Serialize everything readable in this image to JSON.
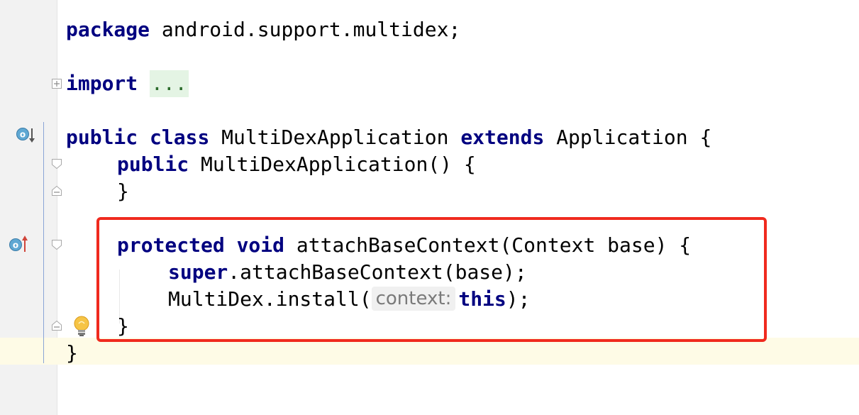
{
  "code": {
    "line_package": {
      "keyword": "package",
      "rest": " android.support.multidex;"
    },
    "line_import": {
      "keyword": "import",
      "space": " ",
      "collapsed": "..."
    },
    "line_class": {
      "kw1": "public",
      "kw2": "class",
      "name": " MultiDexApplication ",
      "kw3": "extends",
      "rest": " Application {"
    },
    "line_ctor": {
      "kw": "public",
      "rest": " MultiDexApplication() {"
    },
    "line_ctor_close": {
      "text": "}"
    },
    "line_method": {
      "kw1": "protected",
      "kw2": "void",
      "rest": " attachBaseContext(Context base) {"
    },
    "line_super": {
      "kw": "super",
      "rest": ".attachBaseContext(base);"
    },
    "line_install": {
      "pre": "MultiDex.install(",
      "hint": "context:",
      "kw": "this",
      "post": ");"
    },
    "line_method_close": {
      "text": "}"
    },
    "line_class_close": {
      "text": "}"
    }
  },
  "icons": {
    "implements_marker": "override-down-icon",
    "overrides_marker": "override-up-icon",
    "intention_bulb": "lightbulb-icon"
  },
  "colors": {
    "keyword": "#000080",
    "highlight_box": "#f02a1e",
    "caret_row": "#fefbe6",
    "folded_bg": "#e4f4e4"
  }
}
